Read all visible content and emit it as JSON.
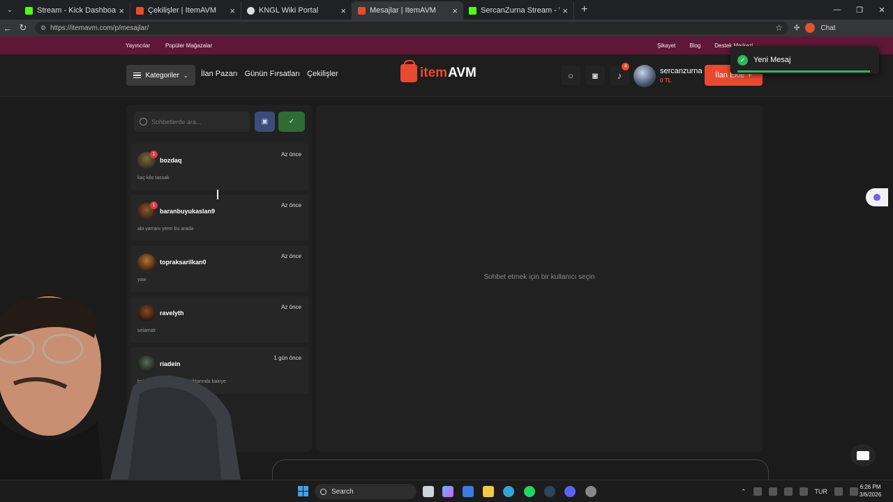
{
  "browser": {
    "tabs": [
      {
        "title": "Stream - Kick Dashboard",
        "color": "#53fc18"
      },
      {
        "title": "Çekilişler | ItemAVM",
        "color": "#e84a30"
      },
      {
        "title": "KNGL Wiki Portal",
        "color": "#dddddd"
      },
      {
        "title": "Mesajlar | ItemAVM",
        "color": "#e84a30",
        "active": true
      },
      {
        "title": "SercanZurna Stream - Watch Live o",
        "color": "#53fc18"
      }
    ],
    "url": "https://itemavm.com/p/mesajlar/",
    "chat_label": "Chat"
  },
  "site": {
    "top_left_links": [
      "Yayıncılar",
      "Popüler Mağazalar"
    ],
    "top_right_links": [
      "Şikayet",
      "Blog",
      "Destek Merkezi"
    ],
    "categories_label": "Kategoriler",
    "nav": [
      "İlan Pazarı",
      "Günün Fırsatları",
      "Çekilişler"
    ],
    "logo_item": "item",
    "logo_avm": "AVM",
    "notification_count": "4",
    "username": "sercanzurna",
    "balance": "0 TL",
    "add_listing_label": "İlan Ekle",
    "add_listing_plus": "+"
  },
  "toast": {
    "text": "Yeni Mesaj"
  },
  "conversations": {
    "search_placeholder": "Sohbetlerde ara...",
    "items": [
      {
        "name": "bozdaq",
        "time": "Az önce",
        "preview": "kaç kilo tassak",
        "unread": "1"
      },
      {
        "name": "baranbuyukaslan9",
        "time": "Az önce",
        "preview": "abi yarranı yerm bu arada",
        "unread": "1"
      },
      {
        "name": "topraksarilkan0",
        "time": "Az önce",
        "preview": "yaw",
        "unread": ""
      },
      {
        "name": "ravelyth",
        "time": "Az önce",
        "preview": "selamalr",
        "unread": ""
      },
      {
        "name": "riadein",
        "time": "1 gün önce",
        "preview": "bakiyenize 10000 TRY miktarında bakiye",
        "unread": ""
      }
    ]
  },
  "chat": {
    "empty_text": "Sohbet etmek için bir kullanıcı seçin"
  },
  "taskbar": {
    "search_label": "Search",
    "language": "TUR",
    "time": "6:26 PM",
    "date": "3/6/2026"
  },
  "colors": {
    "brand": "#e84a30",
    "topstrip": "#5f1736",
    "success": "#2eb85c"
  }
}
